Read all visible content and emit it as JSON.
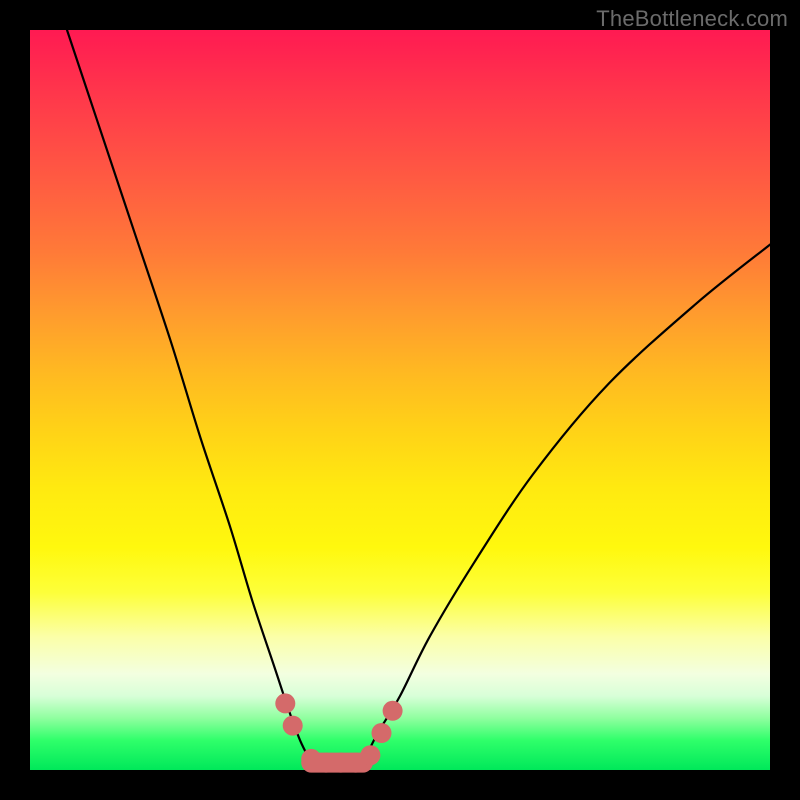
{
  "watermark": "TheBottleneck.com",
  "colors": {
    "background": "#000000",
    "curve": "#000000",
    "marker": "#d46a6a",
    "gradient_stops": [
      "#ff1a52",
      "#ff5a42",
      "#ff9a2e",
      "#ffd217",
      "#fff80e",
      "#fbffa8",
      "#d8ffd8",
      "#2fff6a",
      "#00e85a"
    ]
  },
  "chart_data": {
    "type": "line",
    "title": "",
    "xlabel": "",
    "ylabel": "",
    "xlim": [
      0,
      100
    ],
    "ylim": [
      0,
      100
    ],
    "series": [
      {
        "name": "left-branch",
        "x": [
          5,
          9,
          14,
          19,
          23,
          27,
          30,
          33,
          35,
          36.5,
          38
        ],
        "y": [
          100,
          88,
          73,
          58,
          45,
          33,
          23,
          14,
          8,
          4,
          1
        ]
      },
      {
        "name": "right-branch",
        "x": [
          45,
          47,
          50,
          54,
          60,
          68,
          78,
          90,
          100
        ],
        "y": [
          1,
          5,
          10,
          18,
          28,
          40,
          52,
          63,
          71
        ]
      },
      {
        "name": "valley-floor",
        "x": [
          38,
          45
        ],
        "y": [
          1,
          1
        ]
      }
    ],
    "markers": {
      "name": "highlight-dots",
      "x": [
        34.5,
        35.5,
        38,
        40,
        42,
        44,
        46,
        47.5,
        49
      ],
      "y": [
        9,
        6,
        1.5,
        1,
        1,
        1,
        2,
        5,
        8
      ]
    },
    "annotations": []
  }
}
